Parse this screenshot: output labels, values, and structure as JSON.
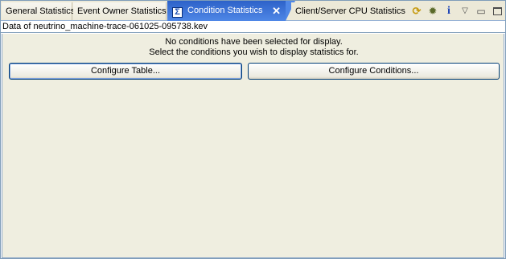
{
  "tabs": [
    {
      "label": "General Statistics"
    },
    {
      "label": "Event Owner Statistics"
    },
    {
      "label": "Condition Statistics",
      "icon": "sigma-icon",
      "active": true,
      "close": "✕"
    },
    {
      "label": "Client/Server CPU Statistics"
    }
  ],
  "toolbar": {
    "icons": [
      "refresh-icon",
      "bug-icon",
      "info-icon",
      "view-menu-icon",
      "minimize-icon",
      "maximize-icon"
    ],
    "info_glyph": "i"
  },
  "subheader": {
    "text": "Data of neutrino_machine-trace-061025-095738.kev"
  },
  "message": {
    "line1": "No conditions have been selected for display.",
    "line2": "Select the conditions you wish to display statistics for."
  },
  "buttons": {
    "configure_table": "Configure Table...",
    "configure_conditions": "Configure Conditions..."
  },
  "colors": {
    "active_tab": "#2d62c9",
    "content_bg": "#efeee0",
    "tabbar_bg": "#ece9d8"
  }
}
